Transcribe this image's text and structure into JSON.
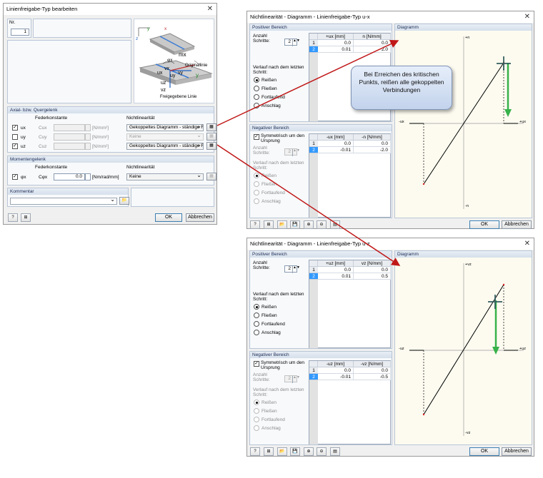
{
  "dialog1": {
    "title": "Linienfreigabe-Typ bearbeiten",
    "nr_label": "Nr.",
    "nr_value": "1",
    "image_labels": {
      "originallinie": "Originallinie",
      "freigegebene": "Freigegebene Linie",
      "mx": "mx",
      "phix": "φx",
      "ux": "ux",
      "uy": "uy",
      "uz": "uz",
      "vx": "vx",
      "vy": "vy",
      "vz": "vz",
      "x": "x",
      "y": "y",
      "z": "z"
    },
    "axial_title": "Axial- bzw. Quergelenk",
    "federkonstante": "Federkonstante",
    "nichtlinearitaet": "Nichtlinearität",
    "rows": [
      {
        "sym": "ux",
        "c": "Cux",
        "unit": "[N/mm²]",
        "nl": "Gekoppeltes Diagramm - ständige Fr",
        "checked": true
      },
      {
        "sym": "uy",
        "c": "Cuy",
        "unit": "[N/mm²]",
        "nl": "Keine",
        "checked": false
      },
      {
        "sym": "uz",
        "c": "Cuz",
        "unit": "[N/mm²]",
        "nl": "Gekoppeltes Diagramm - ständige Fr",
        "checked": true
      }
    ],
    "moment_title": "Momentengelenk",
    "moment_row": {
      "sym": "φx",
      "c": "Cφx",
      "value": "0.0",
      "unit": "[Nm/rad/mm]",
      "nl": "Keine"
    },
    "kommentar_title": "Kommentar",
    "ok": "OK",
    "cancel": "Abbrechen",
    "check": "✓"
  },
  "dialogs": [
    {
      "title": "Nichtlinearität - Diagramm - Linienfreigabe-Typ u-x",
      "pos_title": "Positiver Bereich",
      "anzahl": "Anzahl Schritte:",
      "anzahl_val": "2",
      "col1": "+ux [mm]",
      "col2": "n [N/mm]",
      "pos_rows": [
        [
          "1",
          "0.0",
          "0.0"
        ],
        [
          "2",
          "0.01",
          "2.0"
        ]
      ],
      "verlauf": "Verlauf nach dem letzten Schritt:",
      "opts": [
        "Reißen",
        "Fließen",
        "Fortlaufend",
        "Anschlag"
      ],
      "neg_title": "Negativer Bereich",
      "sym": "Symmetrisch um den Ursprung",
      "col1n": "-ux [mm]",
      "col2n": "-n [N/mm]",
      "neg_rows": [
        [
          "1",
          "0.0",
          "0.0"
        ],
        [
          "2",
          "-0.01",
          "-2.0"
        ]
      ],
      "diag_title": "Diagramm",
      "axis_top": "+n",
      "axis_bottom": "-n",
      "axis_left": "-ux",
      "axis_right": "+ux",
      "ok": "OK",
      "cancel": "Abbrechen"
    },
    {
      "title": "Nichtlinearität - Diagramm - Linienfreigabe-Typ u-z",
      "pos_title": "Positiver Bereich",
      "anzahl": "Anzahl Schritte:",
      "anzahl_val": "2",
      "col1": "+uz [mm]",
      "col2": "vz [N/mm]",
      "pos_rows": [
        [
          "1",
          "0.0",
          "0.0"
        ],
        [
          "2",
          "0.01",
          "0.5"
        ]
      ],
      "verlauf": "Verlauf nach dem letzten Schritt:",
      "opts": [
        "Reißen",
        "Fließen",
        "Fortlaufend",
        "Anschlag"
      ],
      "neg_title": "Negativer Bereich",
      "sym": "Symmetrisch um den Ursprung",
      "col1n": "-uz [mm]",
      "col2n": "-vz [N/mm]",
      "neg_rows": [
        [
          "1",
          "0.0",
          "0.0"
        ],
        [
          "2",
          "-0.01",
          "-0.5"
        ]
      ],
      "diag_title": "Diagramm",
      "axis_top": "+vz",
      "axis_bottom": "-vz",
      "axis_left": "-uz",
      "axis_right": "+uz",
      "ok": "OK",
      "cancel": "Abbrechen"
    }
  ],
  "callout": "Bei Erreichen des kritischen Punkts, reißen alle gekoppelten Verbindungen",
  "colors": {
    "arrow": "#c01717",
    "green": "#37b24a",
    "accent": "#3399ff"
  }
}
